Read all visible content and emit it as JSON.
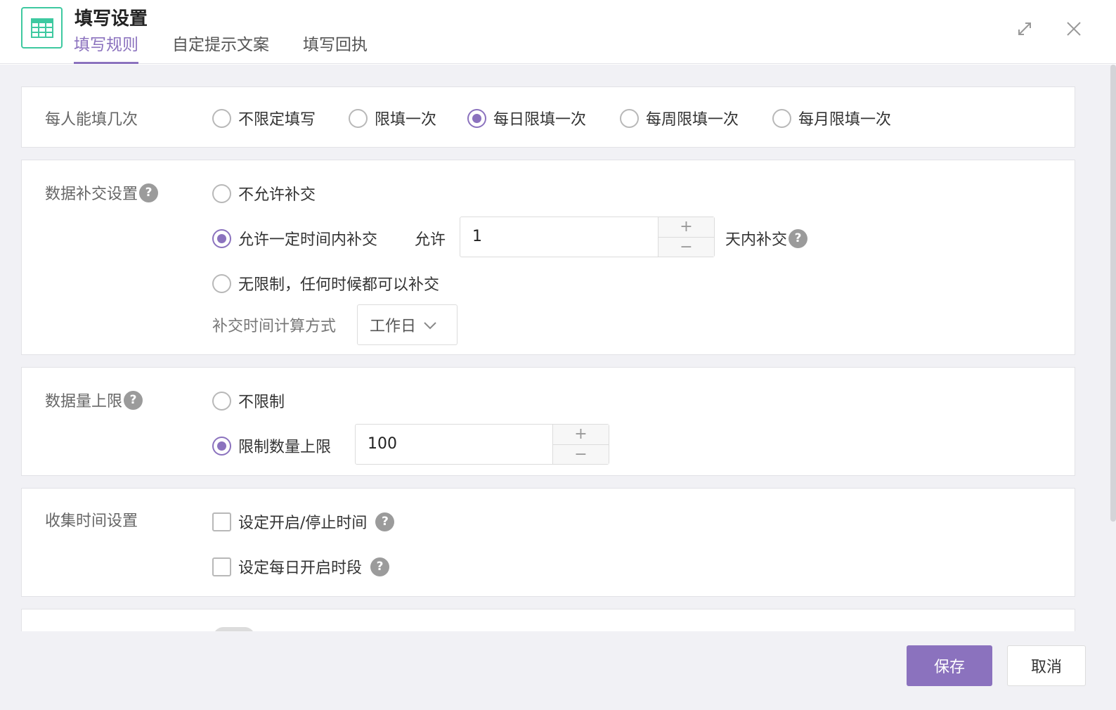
{
  "header": {
    "title": "填写设置",
    "icon": "table-icon",
    "tabs": [
      {
        "label": "填写规则",
        "active": true
      },
      {
        "label": "自定提示文案",
        "active": false
      },
      {
        "label": "填写回执",
        "active": false
      }
    ],
    "expand_icon": "expand-icon",
    "close_icon": "close-icon"
  },
  "theme": {
    "accent": "#8b72be",
    "icon_green": "#3ec9a0"
  },
  "fill_limit": {
    "label": "每人能填几次",
    "options": [
      {
        "label": "不限定填写",
        "selected": false
      },
      {
        "label": "限填一次",
        "selected": false
      },
      {
        "label": "每日限填一次",
        "selected": true
      },
      {
        "label": "每周限填一次",
        "selected": false
      },
      {
        "label": "每月限填一次",
        "selected": false
      }
    ]
  },
  "resubmit": {
    "label": "数据补交设置",
    "help": "?",
    "option_none": "不允许补交",
    "option_within": "允许一定时间内补交",
    "allow_prefix": "允许",
    "days_value": "1",
    "days_suffix": "天内补交",
    "option_unlimited": "无限制，任何时候都可以补交",
    "calc_label": "补交时间计算方式",
    "calc_value": "工作日",
    "selected": "within"
  },
  "data_limit": {
    "label": "数据量上限",
    "help": "?",
    "option_none": "不限制",
    "option_limit": "限制数量上限",
    "limit_value": "100",
    "selected": "limit"
  },
  "collect_time": {
    "label": "收集时间设置",
    "option_start_stop": "设定开启/停止时间",
    "option_daily": "设定每日开启时段",
    "help": "?"
  },
  "stepper": {
    "plus": "+",
    "minus": "−"
  },
  "footer": {
    "save": "保存",
    "cancel": "取消"
  }
}
